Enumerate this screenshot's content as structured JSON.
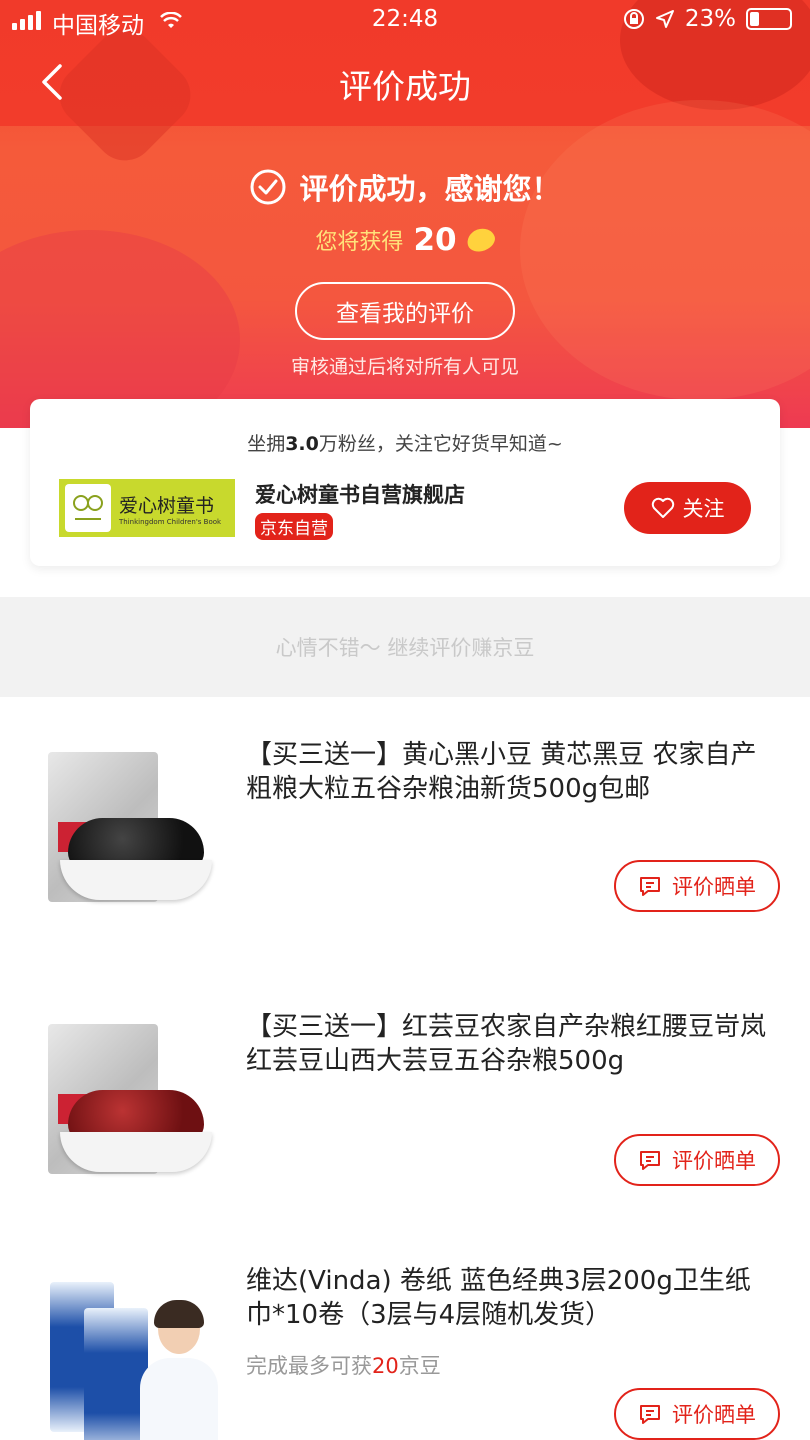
{
  "status_bar": {
    "carrier": "中国移动",
    "time": "22:48",
    "battery": "23%"
  },
  "nav": {
    "title": "评价成功"
  },
  "success": {
    "message": "评价成功，感谢您！",
    "reward_label": "您将获得",
    "reward_value": "20",
    "view_button": "查看我的评价",
    "note": "审核通过后将对所有人可见"
  },
  "store": {
    "fans_prefix": "坐拥",
    "fans_count": "3.0",
    "fans_suffix": "万粉丝，关注它好货早知道~",
    "logo_cn": "爱心树童书",
    "logo_en": "Thinkingdom Children's Book",
    "name": "爱心树童书自营旗舰店",
    "tag": "京东自营",
    "follow_label": "关注"
  },
  "prompt": "心情不错～ 继续评价赚京豆",
  "products": [
    {
      "title": "【买三送一】黄心黑小豆 黄芯黑豆 农家自产粗粮大粒五谷杂粮油新货500g包邮",
      "button": "评价晒单"
    },
    {
      "title": "【买三送一】红芸豆农家自产杂粮红腰豆岢岚红芸豆山西大芸豆五谷杂粮500g",
      "button": "评价晒单"
    },
    {
      "title": "维达(Vinda) 卷纸 蓝色经典3层200g卫生纸巾*10卷（3层与4层随机发货）",
      "sub_prefix": "完成最多可获",
      "sub_value": "20",
      "sub_suffix": "京豆",
      "button": "评价晒单"
    }
  ],
  "colors": {
    "primary_red": "#e2231a",
    "header_red": "#f13a2a",
    "reward_gold": "#ffe27a"
  },
  "icons": [
    "back-chevron-icon",
    "check-circle-icon",
    "jd-bean-icon",
    "heart-icon",
    "comment-icon",
    "wifi-icon",
    "location-arrow-icon",
    "lock-rotation-icon"
  ]
}
